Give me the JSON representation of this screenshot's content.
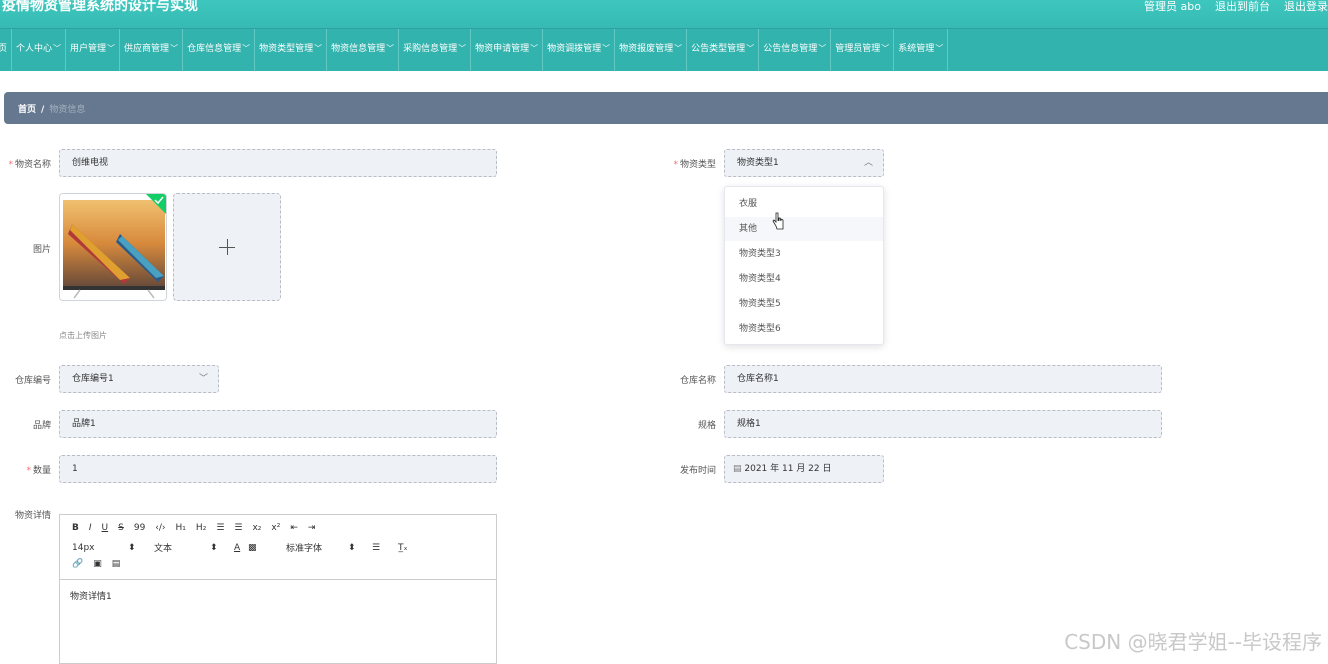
{
  "header": {
    "title": "疫情物资管理系统的设计与实现",
    "user_label": "管理员 abo",
    "front_link": "退出到前台",
    "logout_link": "退出登录"
  },
  "nav": {
    "items": [
      "页",
      "个人中心",
      "用户管理",
      "供应商管理",
      "仓库信息管理",
      "物资类型管理",
      "物资信息管理",
      "采购信息管理",
      "物资申请管理",
      "物资调拨管理",
      "物资报废管理",
      "公告类型管理",
      "公告信息管理",
      "管理员管理",
      "系统管理"
    ]
  },
  "breadcrumb": {
    "home": "首页",
    "separator": "/",
    "current": "物资信息"
  },
  "form": {
    "name_label": "物资名称",
    "name_value": "创维电视",
    "type_label": "物资类型",
    "type_value": "物资类型1",
    "image_label": "图片",
    "upload_hint": "点击上传图片",
    "warehouse_no_label": "仓库编号",
    "warehouse_no_value": "仓库编号1",
    "warehouse_name_label": "仓库名称",
    "warehouse_name_value": "仓库名称1",
    "brand_label": "品牌",
    "brand_value": "品牌1",
    "spec_label": "规格",
    "spec_value": "规格1",
    "qty_label": "数量",
    "qty_value": "1",
    "publish_label": "发布时间",
    "publish_value": "2021 年 11 月 22 日",
    "detail_label": "物资详情",
    "detail_value": "物资详情1"
  },
  "type_options": [
    "衣服",
    "其他",
    "物资类型3",
    "物资类型4",
    "物资类型5",
    "物资类型6"
  ],
  "editor": {
    "row1": [
      "B",
      "I",
      "U",
      "S",
      "99",
      "‹/›",
      "H₁",
      "H₂",
      "☰",
      "☰",
      "x₂",
      "x²",
      "⇤",
      "⇥"
    ],
    "font_size": "14px",
    "paragraph": "文本",
    "font_family": "标准字体"
  },
  "watermark": "CSDN @晓君学姐--毕设程序",
  "colors": {
    "header": "#3dc7be",
    "nav": "#33b3ad",
    "breadcrumb": "#66788f",
    "field_bg": "#eef1f6",
    "required": "#f56c6c"
  }
}
